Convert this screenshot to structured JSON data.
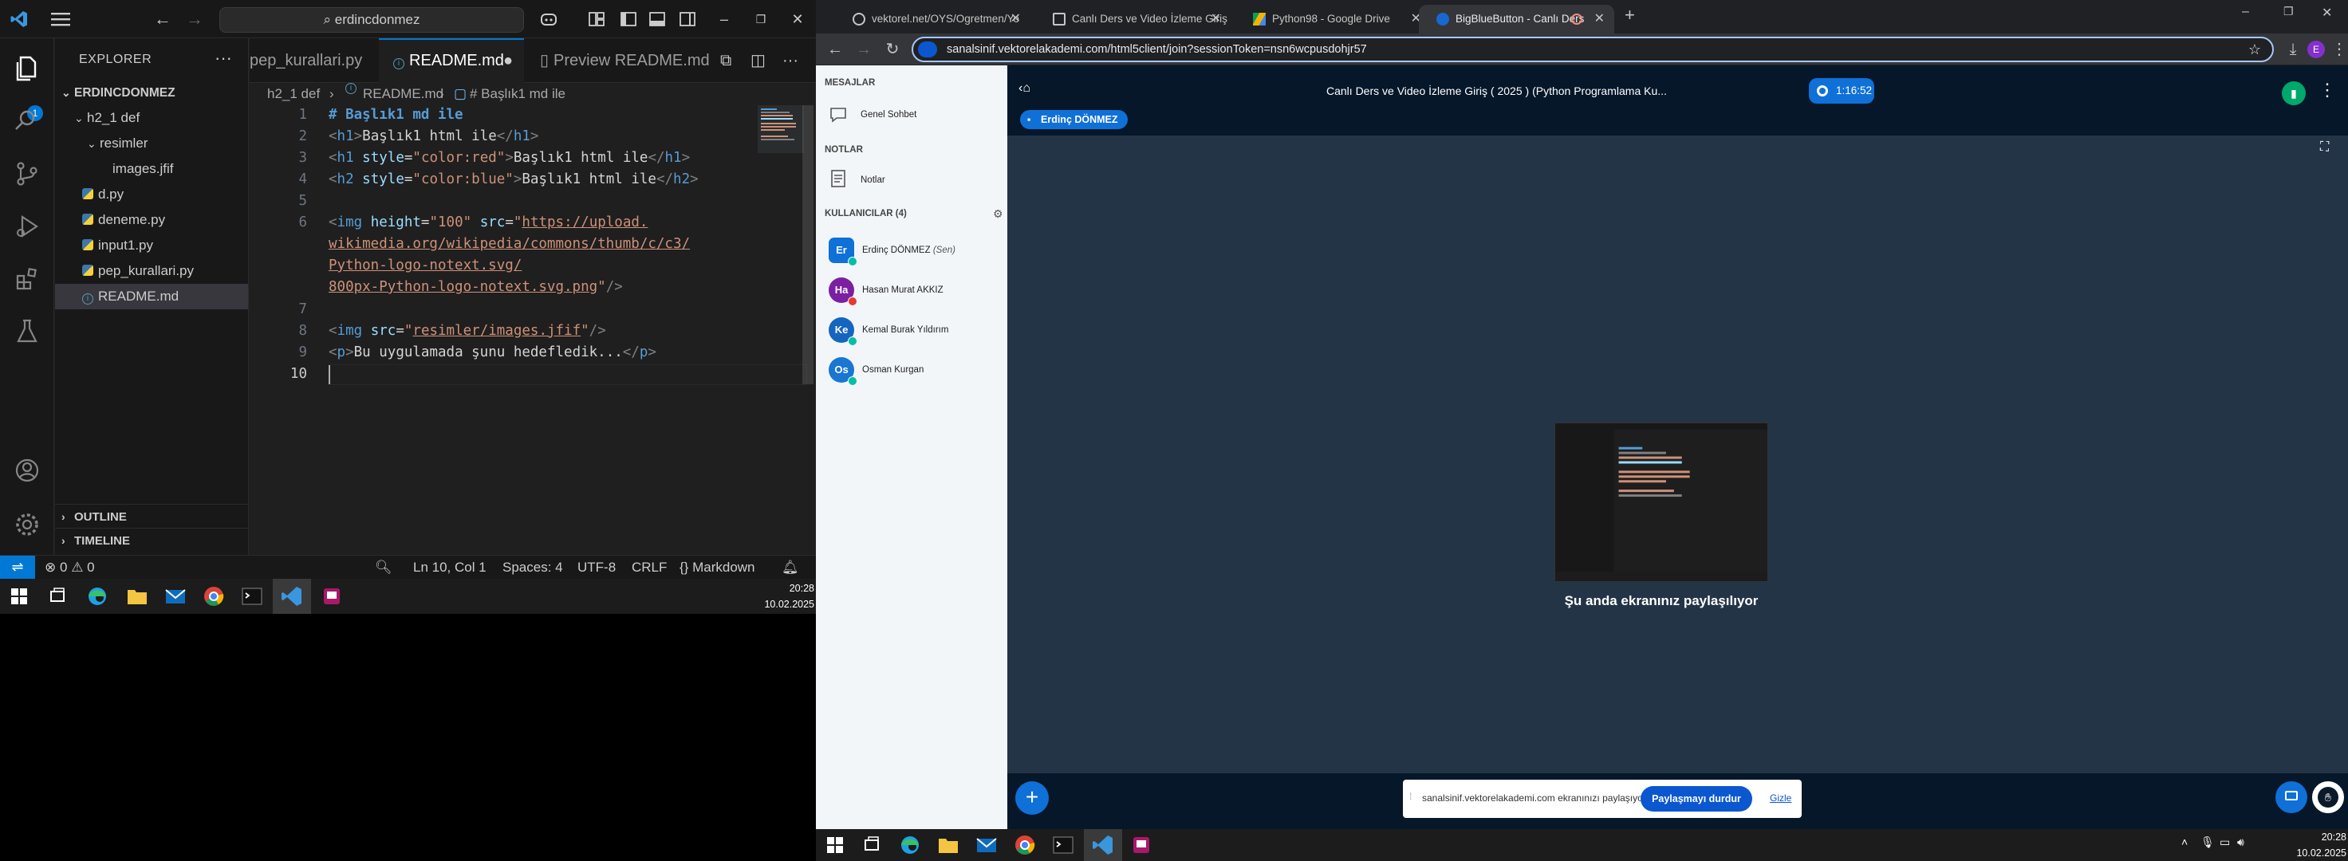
{
  "vscode": {
    "search_text": "erdincdonmez",
    "explorer_title": "EXPLORER",
    "badge": "1",
    "tree": [
      {
        "label": "ERDINCDONMEZ",
        "type": "root"
      },
      {
        "label": "h2_1 def",
        "type": "folder"
      },
      {
        "label": "resimler",
        "type": "folder"
      },
      {
        "label": "images.jfif",
        "type": "file"
      },
      {
        "label": "d.py",
        "type": "py"
      },
      {
        "label": "deneme.py",
        "type": "py"
      },
      {
        "label": "input1.py",
        "type": "py"
      },
      {
        "label": "pep_kurallari.py",
        "type": "py"
      },
      {
        "label": "README.md",
        "type": "md"
      }
    ],
    "outline": "OUTLINE",
    "timeline": "TIMELINE",
    "tabs": [
      "pep_kurallari.py",
      "README.md",
      "Preview README.md"
    ],
    "breadcrumb": [
      "h2_1 def",
      "README.md",
      "# Başlık1 md ile"
    ],
    "line_numbers": [
      "1",
      "2",
      "3",
      "4",
      "5",
      "6",
      "",
      "",
      "",
      "7",
      "8",
      "9",
      "10"
    ],
    "status": {
      "errors": "0",
      "warnings": "0",
      "position": "Ln 10, Col 1",
      "spaces": "Spaces: 4",
      "encoding": "UTF-8",
      "eol": "CRLF",
      "language": "Markdown"
    },
    "clock_time": "20:28",
    "clock_date": "10.02.2025"
  },
  "browser": {
    "tabs": [
      {
        "title": "vektorel.net/OYS/Ogretmen/Yo"
      },
      {
        "title": "Canlı Ders ve Video İzleme Giriş"
      },
      {
        "title": "Python98 - Google Drive"
      },
      {
        "title": "BigBlueButton - Canlı Ders"
      }
    ],
    "url": "sanalsinif.vektorelakademi.com/html5client/join?sessionToken=nsn6wcpusdohjr57",
    "profile": "E"
  },
  "bbb": {
    "messages_label": "MESAJLAR",
    "public_chat": "Genel Sohbet",
    "notes_label": "NOTLAR",
    "notes": "Notlar",
    "users_label": "KULLANICILAR (4)",
    "users": [
      {
        "initials": "Er",
        "name": "Erdinç DÖNMEZ",
        "you": "(Sen)",
        "color": "#0f70d7"
      },
      {
        "initials": "Ha",
        "name": "Hasan Murat AKKIZ",
        "you": "",
        "color": "#7b1fa2"
      },
      {
        "initials": "Ke",
        "name": "Kemal Burak Yıldırım",
        "you": "",
        "color": "#1565c0"
      },
      {
        "initials": "Os",
        "name": "Osman Kurgan",
        "you": "",
        "color": "#1976d2"
      }
    ],
    "title": "Canlı Ders ve Video İzleme Giriş ( 2025 ) (Python Programlama Ku...",
    "timer": "1:16:52",
    "presenter": "Erdinç DÖNMEZ",
    "share_message": "Şu anda ekranınız paylaşılıyor",
    "notice_text": "sanalsinif.vektorelakademi.com ekranınızı paylaşıyor.",
    "stop_button": "Paylaşmayı durdur",
    "hide_link": "Gizle"
  },
  "taskbar_right": {
    "clock_time": "20:28",
    "clock_date": "10.02.2025"
  }
}
